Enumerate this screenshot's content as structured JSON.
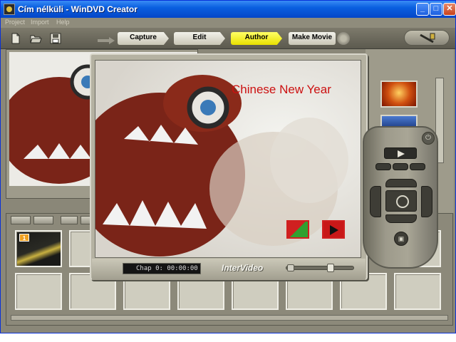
{
  "window": {
    "title": "Cím nélküli - WinDVD Creator",
    "min_label": "_",
    "max_label": "□",
    "close_label": "✕"
  },
  "menu": {
    "items": [
      "Project",
      "Import",
      "Help"
    ]
  },
  "steps": {
    "capture": "Capture",
    "edit": "Edit",
    "author": "Author",
    "make_movie": "Make Movie",
    "active": "Author"
  },
  "player": {
    "menu_title": "Chinese New Year",
    "chapter_display": "Chap 0:     00:00:00",
    "brand": "InterVideo",
    "volume_fraction": 0.68
  },
  "filmstrip": {
    "first_slot_badge": "1",
    "slot_count": 16
  },
  "colors": {
    "accent_active_step": "#ffff33",
    "menu_title": "#cc1010",
    "titlebar": "#0a5fe0",
    "app_chrome": "#8a8778"
  },
  "icons": {
    "new": "new-file-icon",
    "open": "open-folder-icon",
    "save": "save-disk-icon",
    "settings": "gear-icon",
    "tools": "tools-icon"
  }
}
